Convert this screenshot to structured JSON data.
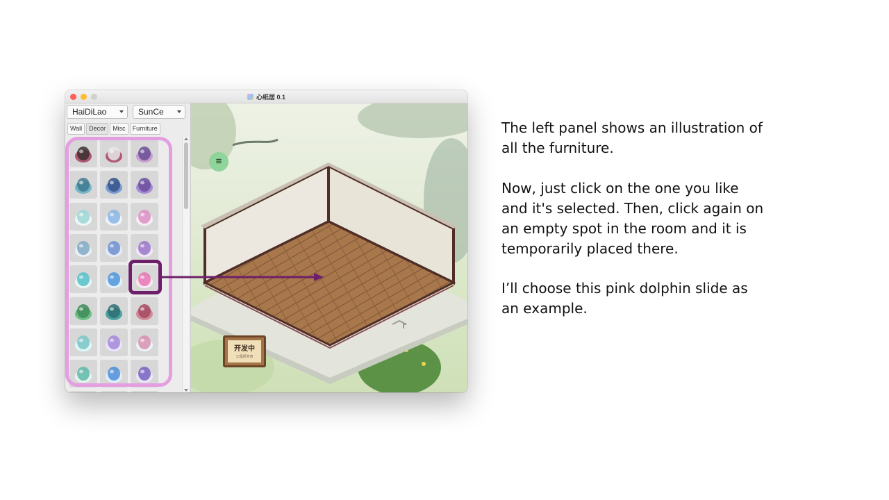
{
  "window": {
    "title": "心纸居 0.1"
  },
  "left_panel": {
    "dropdown_1": "HaiDiLao",
    "dropdown_2": "SunCe",
    "tabs": [
      {
        "label": "Wall"
      },
      {
        "label": "Decor"
      },
      {
        "label": "Misc"
      },
      {
        "label": "Furniture"
      }
    ],
    "items": [
      {
        "name": "vase-dark",
        "colors": [
          "#3b3030",
          "#b05a73"
        ]
      },
      {
        "name": "vase-white",
        "colors": [
          "#e8e8e8",
          "#b05a73"
        ]
      },
      {
        "name": "vase-purple",
        "colors": [
          "#6a4d96",
          "#c8a0d0"
        ]
      },
      {
        "name": "coral-rock-teal",
        "colors": [
          "#3f7a8f",
          "#76b6c7"
        ]
      },
      {
        "name": "coral-rock-blue",
        "colors": [
          "#34538a",
          "#7b9bd0"
        ]
      },
      {
        "name": "coral-rock-purple",
        "colors": [
          "#6b4f9e",
          "#a58ad6"
        ]
      },
      {
        "name": "shell-teal",
        "colors": [
          "#9ed6d6",
          "#eef6f6"
        ]
      },
      {
        "name": "shell-blue",
        "colors": [
          "#8ab5e3",
          "#eef3fb"
        ]
      },
      {
        "name": "shell-pink",
        "colors": [
          "#dc8fc4",
          "#f8eef6"
        ]
      },
      {
        "name": "shell-arch-teal",
        "colors": [
          "#80a9c4",
          "#e6f0f5"
        ]
      },
      {
        "name": "shell-arch-blue",
        "colors": [
          "#6e8fd0",
          "#e4ebf8"
        ]
      },
      {
        "name": "shell-arch-purple",
        "colors": [
          "#9a76c9",
          "#efe7f8"
        ]
      },
      {
        "name": "dolphin-slide-teal",
        "colors": [
          "#56c0c8",
          "#e8f6f6"
        ]
      },
      {
        "name": "dolphin-slide-blue",
        "colors": [
          "#4f95d9",
          "#e3f0fb"
        ]
      },
      {
        "name": "dolphin-slide-pink",
        "colors": [
          "#e676b4",
          "#fbe8f3"
        ]
      },
      {
        "name": "seaweed-green",
        "colors": [
          "#3f8a5a",
          "#6bbf85"
        ]
      },
      {
        "name": "seaweed-teal",
        "colors": [
          "#2f6f72",
          "#4aa3a0"
        ]
      },
      {
        "name": "seaweed-red",
        "colors": [
          "#a44a62",
          "#d28a9a"
        ]
      },
      {
        "name": "pool-shell-teal",
        "colors": [
          "#7cc6c8",
          "#dff7f8"
        ]
      },
      {
        "name": "pool-shell-purple",
        "colors": [
          "#a48ad8",
          "#ebe3fb"
        ]
      },
      {
        "name": "pool-shell-pink",
        "colors": [
          "#d98fb1",
          "#e9f4f6"
        ]
      },
      {
        "name": "chair-teal",
        "colors": [
          "#5fb8a8",
          "#e6f3f2"
        ]
      },
      {
        "name": "chair-blue",
        "colors": [
          "#4f8ed8",
          "#e3eefb"
        ]
      },
      {
        "name": "chair-purple",
        "colors": [
          "#7761c0",
          "#ece7f8"
        ]
      },
      {
        "name": "item-partial-1",
        "colors": [
          "#777777",
          "#bbbbbb"
        ]
      },
      {
        "name": "item-partial-2",
        "colors": [
          "#777777",
          "#bbbbbb"
        ]
      },
      {
        "name": "item-partial-3",
        "colors": [
          "#777777",
          "#bbbbbb"
        ]
      }
    ]
  },
  "game_view": {
    "menu_icon": "hamburger-icon",
    "sign_title": "开发中",
    "sign_subtitle": "工程师养育"
  },
  "annotation_colors": {
    "panel_highlight": "#e39fe0",
    "item_highlight": "#6e1f6a",
    "arrow": "#6e1f6a"
  },
  "text": {
    "paragraph_1": "The left panel shows an illustration of all the furniture.",
    "paragraph_2": "Now, just click on the one you like and it's selected. Then, click again on an empty spot in the room and it is temporarily placed there.",
    "paragraph_3": "I’ll choose this pink dolphin slide as an example."
  }
}
